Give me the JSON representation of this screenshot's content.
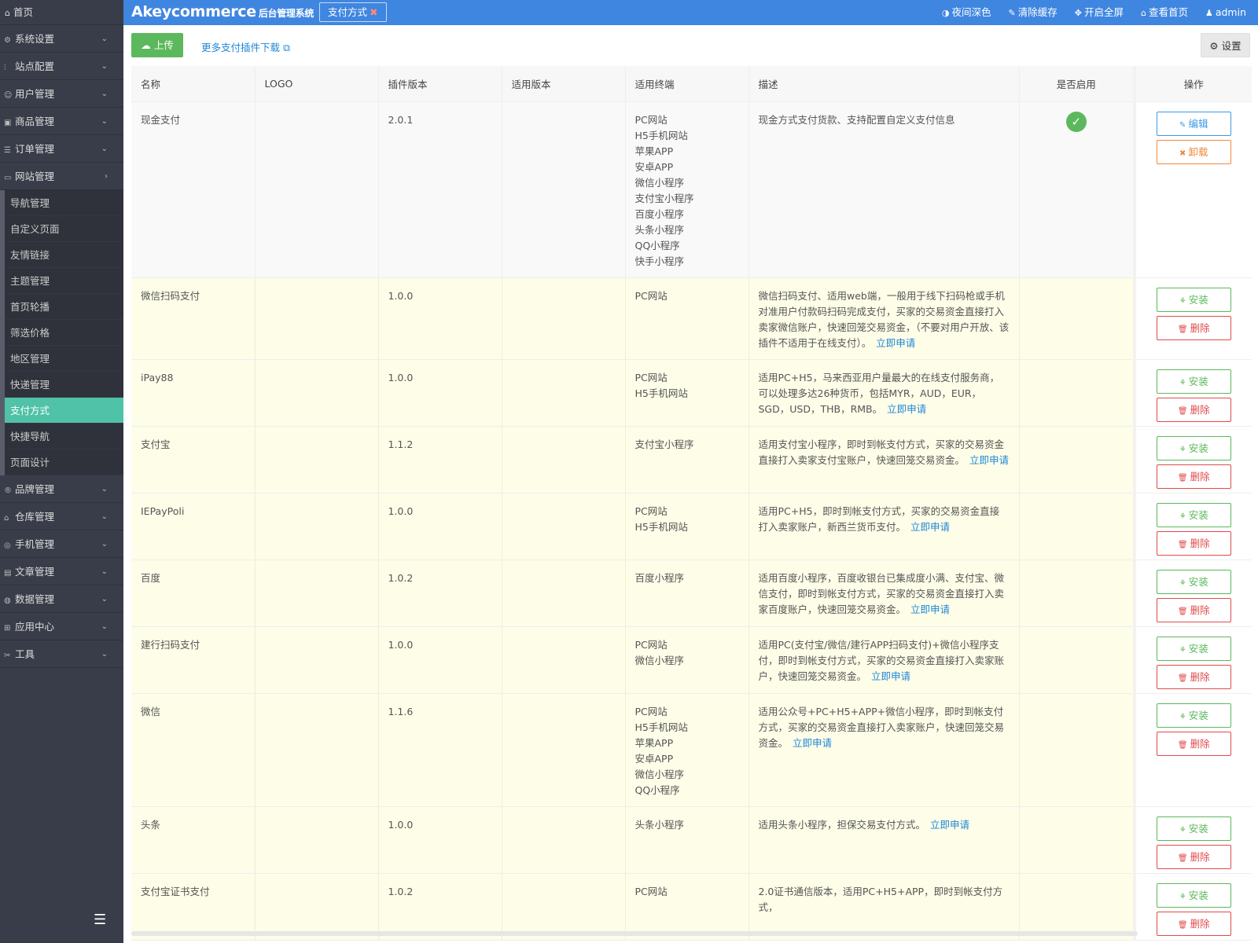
{
  "sidebar": {
    "home": "首页",
    "items": [
      {
        "icon": "gear-icon",
        "glyph": "⚙",
        "label": "系统设置"
      },
      {
        "icon": "sliders-icon",
        "glyph": "⫶",
        "label": "站点配置"
      },
      {
        "icon": "user-icon",
        "glyph": "☺",
        "label": "用户管理"
      },
      {
        "icon": "box-icon",
        "glyph": "▣",
        "label": "商品管理"
      },
      {
        "icon": "list-icon",
        "glyph": "☰",
        "label": "订单管理"
      },
      {
        "icon": "website-icon",
        "glyph": "▭",
        "label": "网站管理"
      }
    ],
    "sub_items": [
      "导航管理",
      "自定义页面",
      "友情链接",
      "主题管理",
      "首页轮播",
      "筛选价格",
      "地区管理",
      "快递管理",
      "支付方式",
      "快捷导航",
      "页面设计"
    ],
    "active_sub": "支付方式",
    "items_after": [
      {
        "icon": "brand-icon",
        "glyph": "®",
        "label": "品牌管理"
      },
      {
        "icon": "warehouse-icon",
        "glyph": "⌂",
        "label": "仓库管理"
      },
      {
        "icon": "mobile-icon",
        "glyph": "◎",
        "label": "手机管理"
      },
      {
        "icon": "article-icon",
        "glyph": "▤",
        "label": "文章管理"
      },
      {
        "icon": "database-icon",
        "glyph": "◍",
        "label": "数据管理"
      },
      {
        "icon": "apps-icon",
        "glyph": "⊞",
        "label": "应用中心"
      },
      {
        "icon": "tools-icon",
        "glyph": "✂",
        "label": "工具"
      }
    ]
  },
  "header": {
    "brand": "Akeycommerce",
    "brand_sub": "后台管理系统",
    "tab": "支付方式",
    "links": [
      {
        "icon": "half-circle-icon",
        "glyph": "◑",
        "label": "夜间深色"
      },
      {
        "icon": "brush-icon",
        "glyph": "✎",
        "label": "清除缓存"
      },
      {
        "icon": "fullscreen-icon",
        "glyph": "✥",
        "label": "开启全屏"
      },
      {
        "icon": "home-icon",
        "glyph": "⌂",
        "label": "查看首页"
      },
      {
        "icon": "user-icon",
        "glyph": "♟",
        "label": "admin"
      }
    ]
  },
  "toolbar": {
    "upload": "上传",
    "more_link": "更多支付插件下载",
    "settings": "设置"
  },
  "table": {
    "columns": [
      "名称",
      "LOGO",
      "插件版本",
      "适用版本",
      "适用终端",
      "描述",
      "是否启用",
      "操作"
    ],
    "apply_label": "立即申请",
    "buttons": {
      "edit": "编辑",
      "uninstall": "卸载",
      "install": "安装",
      "delete": "删除"
    },
    "rows": [
      {
        "name": "现金支付",
        "version": "2.0.1",
        "terminals": [
          "PC网站",
          "H5手机网站",
          "苹果APP",
          "安卓APP",
          "微信小程序",
          "支付宝小程序",
          "百度小程序",
          "头条小程序",
          "QQ小程序",
          "快手小程序"
        ],
        "desc": "现金方式支付货款、支持配置自定义支付信息",
        "apply": false,
        "enabled": true,
        "installed": true
      },
      {
        "name": "微信扫码支付",
        "version": "1.0.0",
        "terminals": [
          "PC网站"
        ],
        "desc": "微信扫码支付、适用web端，一般用于线下扫码枪或手机对准用户付款码扫码完成支付，买家的交易资金直接打入卖家微信账户，快速回笼交易资金，（不要对用户开放、该插件不适用于在线支付）。",
        "apply": true,
        "enabled": false,
        "installed": false
      },
      {
        "name": "iPay88",
        "version": "1.0.0",
        "terminals": [
          "PC网站",
          "H5手机网站"
        ],
        "desc": "适用PC+H5，马来西亚用户量最大的在线支付服务商，可以处理多达26种货币，包括MYR，AUD，EUR，SGD，USD，THB，RMB。",
        "apply": true,
        "enabled": false,
        "installed": false
      },
      {
        "name": "支付宝",
        "version": "1.1.2",
        "terminals": [
          "支付宝小程序"
        ],
        "desc": "适用支付宝小程序，即时到帐支付方式，买家的交易资金直接打入卖家支付宝账户，快速回笼交易资金。",
        "apply": true,
        "enabled": false,
        "installed": false
      },
      {
        "name": "IEPayPoli",
        "version": "1.0.0",
        "terminals": [
          "PC网站",
          "H5手机网站"
        ],
        "desc": "适用PC+H5，即时到帐支付方式，买家的交易资金直接打入卖家账户，新西兰货币支付。",
        "apply": true,
        "enabled": false,
        "installed": false
      },
      {
        "name": "百度",
        "version": "1.0.2",
        "terminals": [
          "百度小程序"
        ],
        "desc": "适用百度小程序，百度收银台已集成度小满、支付宝、微信支付，即时到帐支付方式，买家的交易资金直接打入卖家百度账户，快速回笼交易资金。",
        "apply": true,
        "enabled": false,
        "installed": false
      },
      {
        "name": "建行扫码支付",
        "version": "1.0.0",
        "terminals": [
          "PC网站",
          "微信小程序"
        ],
        "desc": "适用PC(支付宝/微信/建行APP扫码支付)+微信小程序支付，即时到帐支付方式，买家的交易资金直接打入卖家账户，快速回笼交易资金。",
        "apply": true,
        "enabled": false,
        "installed": false
      },
      {
        "name": "微信",
        "version": "1.1.6",
        "terminals": [
          "PC网站",
          "H5手机网站",
          "苹果APP",
          "安卓APP",
          "微信小程序",
          "QQ小程序"
        ],
        "desc": "适用公众号+PC+H5+APP+微信小程序，即时到帐支付方式，买家的交易资金直接打入卖家账户，快速回笼交易资金。",
        "apply": true,
        "enabled": false,
        "installed": false
      },
      {
        "name": "头条",
        "version": "1.0.0",
        "terminals": [
          "头条小程序"
        ],
        "desc": "适用头条小程序，担保交易支付方式。",
        "apply": true,
        "enabled": false,
        "installed": false
      },
      {
        "name": "支付宝证书支付",
        "version": "1.0.2",
        "terminals": [
          "PC网站"
        ],
        "desc": "2.0证书通信版本，适用PC+H5+APP，即时到帐支付方式，",
        "apply": false,
        "enabled": false,
        "installed": false
      }
    ]
  }
}
